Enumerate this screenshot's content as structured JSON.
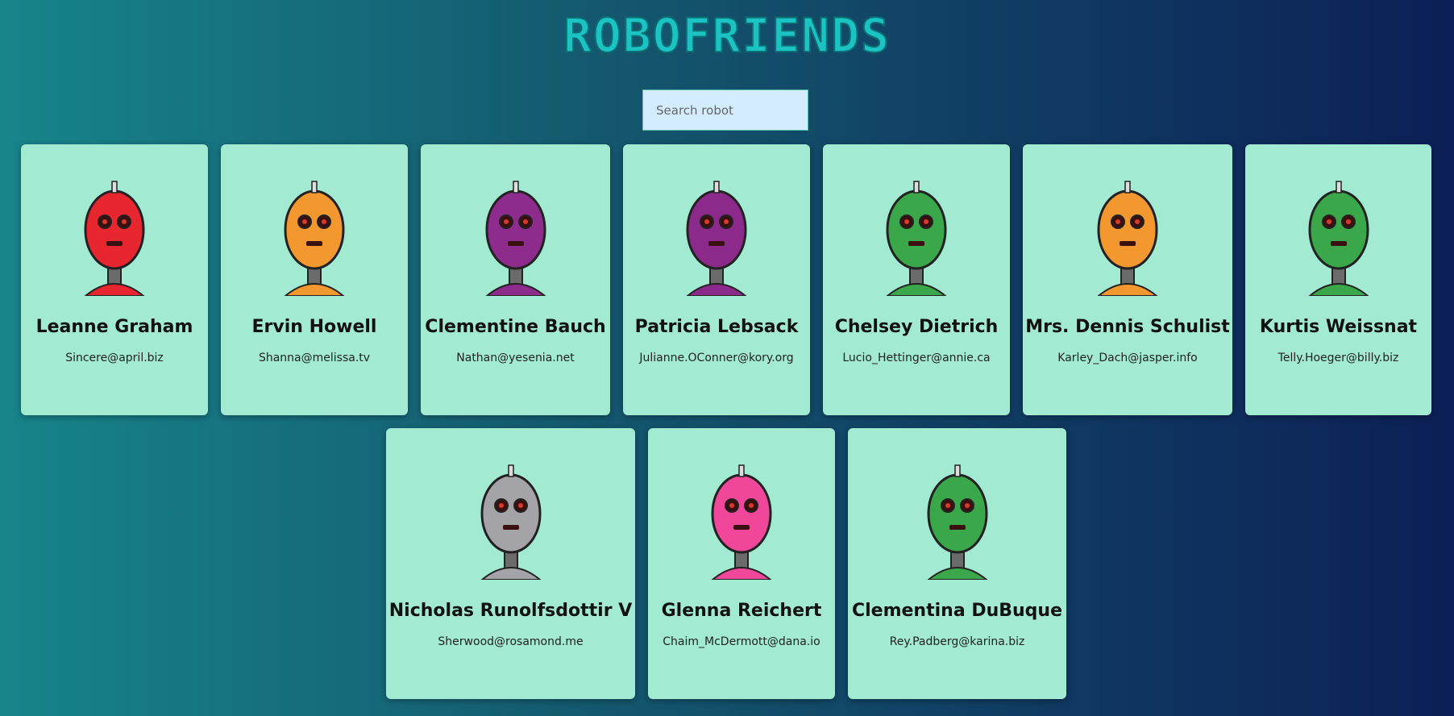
{
  "app": {
    "title": "ROBOFRIENDS"
  },
  "search": {
    "placeholder": "Search robot"
  },
  "robots": [
    {
      "name": "Leanne Graham",
      "email": "Sincere@april.biz",
      "color": "#e8262f",
      "icon": "red-robot-icon"
    },
    {
      "name": "Ervin Howell",
      "email": "Shanna@melissa.tv",
      "color": "#f2982e",
      "icon": "orange-robot-icon"
    },
    {
      "name": "Clementine Bauch",
      "email": "Nathan@yesenia.net",
      "color": "#8e2c8e",
      "icon": "purple-robot-icon"
    },
    {
      "name": "Patricia Lebsack",
      "email": "Julianne.OConner@kory.org",
      "color": "#8b2a8b",
      "icon": "purple-robot-icon"
    },
    {
      "name": "Chelsey Dietrich",
      "email": "Lucio_Hettinger@annie.ca",
      "color": "#3aa84a",
      "icon": "green-robot-icon"
    },
    {
      "name": "Mrs. Dennis Schulist",
      "email": "Karley_Dach@jasper.info",
      "color": "#f2982e",
      "icon": "orange-robot-icon"
    },
    {
      "name": "Kurtis Weissnat",
      "email": "Telly.Hoeger@billy.biz",
      "color": "#3aa84a",
      "icon": "green-robot-icon"
    },
    {
      "name": "Nicholas Runolfsdottir V",
      "email": "Sherwood@rosamond.me",
      "color": "#a4a4a8",
      "icon": "gray-robot-icon"
    },
    {
      "name": "Glenna Reichert",
      "email": "Chaim_McDermott@dana.io",
      "color": "#f0479a",
      "icon": "pink-robot-icon"
    },
    {
      "name": "Clementina DuBuque",
      "email": "Rey.Padberg@karina.biz",
      "color": "#3aa84a",
      "icon": "green-robot-icon"
    }
  ]
}
